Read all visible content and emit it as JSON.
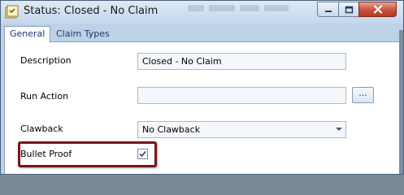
{
  "window": {
    "title": "Status: Closed - No Claim"
  },
  "tabs": [
    {
      "label": "General",
      "active": true
    },
    {
      "label": "Claim Types",
      "active": false
    }
  ],
  "form": {
    "description": {
      "label": "Description",
      "value": "Closed - No Claim"
    },
    "run_action": {
      "label": "Run Action",
      "value": "",
      "browse_label": "..."
    },
    "clawback": {
      "label": "Clawback",
      "value": "No Clawback"
    },
    "bullet_proof": {
      "label": "Bullet Proof",
      "checked": true
    }
  },
  "icons": {
    "app": "status-app-icon",
    "minimize": "minimize-icon",
    "maximize": "maximize-icon",
    "close": "close-icon",
    "dropdown": "chevron-down-icon",
    "check": "checkmark-icon"
  },
  "colors": {
    "highlight_border": "#7a1416",
    "close_button": "#c9503c",
    "title_bar": "#c4d7ec"
  }
}
